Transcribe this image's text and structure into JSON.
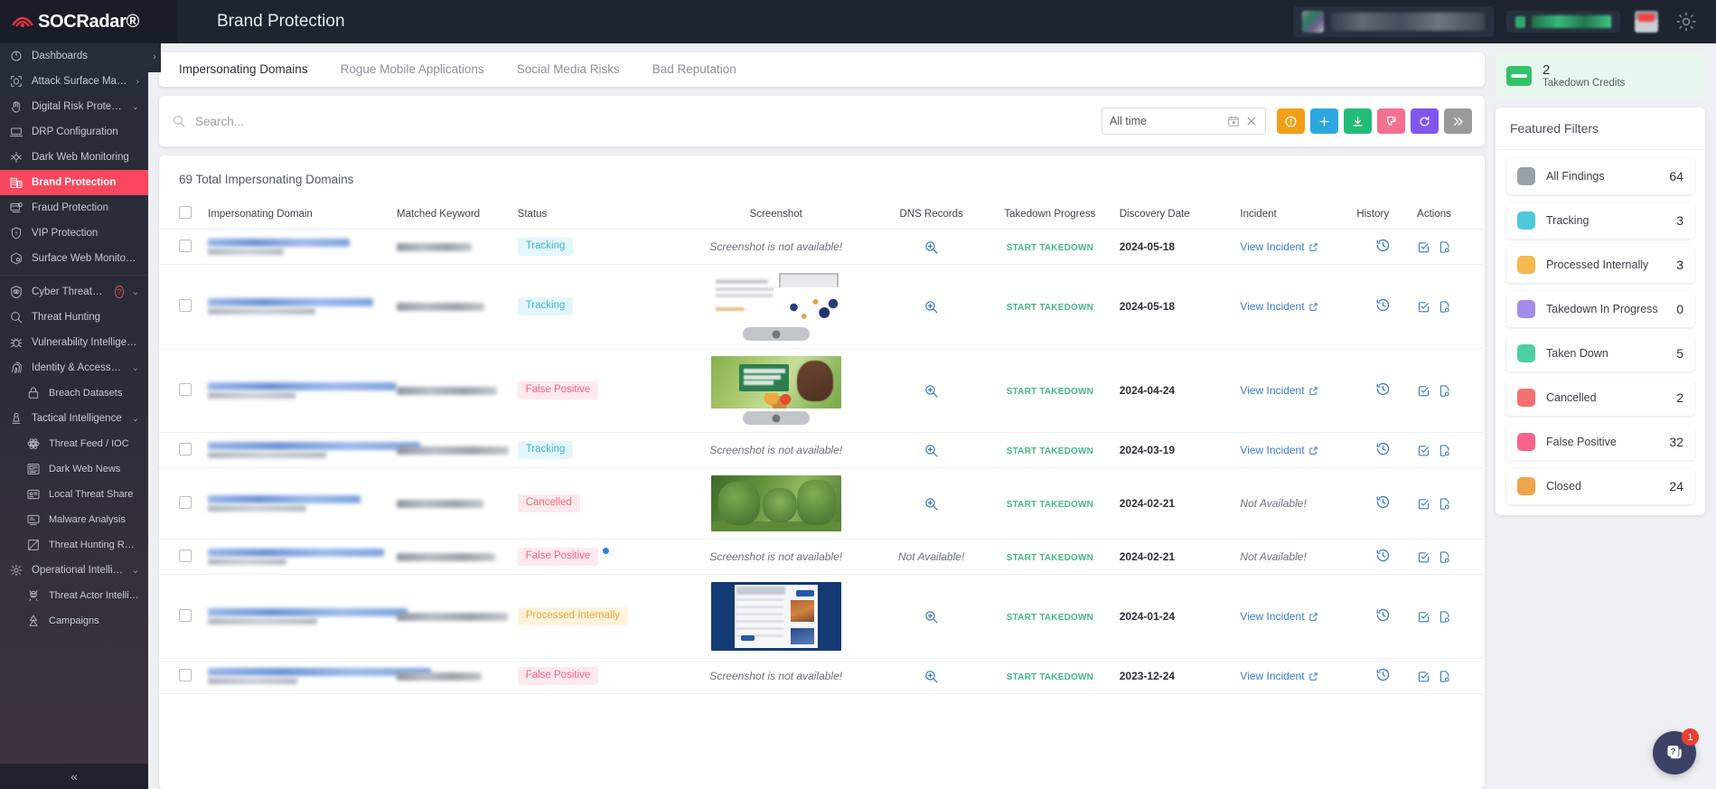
{
  "header": {
    "brand": "SOCRadar",
    "brand_reg": "®",
    "page_title": "Brand Protection",
    "icons": {
      "user_avatar": "avatar",
      "license_status": "license-status",
      "reports": "chart-icon",
      "settings": "gear-icon"
    }
  },
  "sidebar": {
    "collapse_label": "«",
    "items": [
      {
        "label": "Dashboards",
        "icon": "dashboard-icon",
        "type": "item"
      },
      {
        "label": "Attack Surface Management",
        "icon": "attack-surface-icon",
        "type": "item",
        "chevron": "›"
      },
      {
        "label": "Digital Risk Protection",
        "icon": "hand-icon",
        "type": "item",
        "chevron": "⌄",
        "expanded": true
      },
      {
        "label": "DRP Configuration",
        "icon": "laptop-icon",
        "type": "item"
      },
      {
        "label": "Dark Web Monitoring",
        "icon": "spider-icon",
        "type": "item"
      },
      {
        "label": "Brand Protection",
        "icon": "building-icon",
        "type": "item",
        "active": true
      },
      {
        "label": "Fraud Protection",
        "icon": "fraud-icon",
        "type": "item"
      },
      {
        "label": "VIP Protection",
        "icon": "vip-shield-icon",
        "type": "item"
      },
      {
        "label": "Surface Web Monitoring",
        "icon": "web-monitor-icon",
        "type": "item"
      },
      {
        "label": "Cyber Threat Intelligence",
        "icon": "eye-shield-icon",
        "type": "item",
        "chevron": "⌄",
        "badge": "?"
      },
      {
        "label": "Threat Hunting",
        "icon": "search-icon",
        "type": "item"
      },
      {
        "label": "Vulnerability Intelligence",
        "icon": "bug-icon",
        "type": "item"
      },
      {
        "label": "Identity & Access Intelligence",
        "icon": "fingerprint-icon",
        "type": "item",
        "chevron": "⌄"
      },
      {
        "label": "Breach Datasets",
        "icon": "lock-database-icon",
        "type": "sub"
      },
      {
        "label": "Tactical Intelligence",
        "icon": "chess-pawn-icon",
        "type": "item",
        "chevron": "⌄"
      },
      {
        "label": "Threat Feed / IOC",
        "icon": "atom-icon",
        "type": "sub"
      },
      {
        "label": "Dark Web News",
        "icon": "news-icon",
        "type": "sub"
      },
      {
        "label": "Local Threat Share",
        "icon": "share-card-icon",
        "type": "sub"
      },
      {
        "label": "Malware Analysis",
        "icon": "malware-icon",
        "type": "sub"
      },
      {
        "label": "Threat Hunting Rules",
        "icon": "rules-icon",
        "type": "sub"
      },
      {
        "label": "Operational Intelligence",
        "icon": "gear-star-icon",
        "type": "item",
        "chevron": "⌄"
      },
      {
        "label": "Threat Actor Intelligence",
        "icon": "threat-actor-icon",
        "type": "sub"
      },
      {
        "label": "Campaigns",
        "icon": "campaign-icon",
        "type": "sub"
      }
    ]
  },
  "tabs": [
    {
      "label": "Impersonating Domains",
      "active": true
    },
    {
      "label": "Rogue Mobile Applications",
      "active": false
    },
    {
      "label": "Social Media Risks",
      "active": false
    },
    {
      "label": "Bad Reputation",
      "active": false
    }
  ],
  "toolbar": {
    "search_placeholder": "Search...",
    "search_value": "",
    "daterange_value": "All time",
    "buttons": [
      {
        "name": "info-button",
        "icon": "exclamation-circle-icon",
        "color": "#f0a018"
      },
      {
        "name": "add-button",
        "icon": "plus-icon",
        "color": "#2ca8e0"
      },
      {
        "name": "download-button",
        "icon": "download-icon",
        "color": "#23bb78"
      },
      {
        "name": "false-positive-button",
        "icon": "thumbs-down-icon",
        "color": "#f4708f"
      },
      {
        "name": "refresh-button",
        "icon": "refresh-icon",
        "color": "#8156ee"
      },
      {
        "name": "more-button",
        "icon": "double-chevron-right-icon",
        "color": "#9a9a9a"
      }
    ]
  },
  "table": {
    "total_label": "69 Total Impersonating Domains",
    "columns": [
      "Impersonating Domain",
      "Matched Keyword",
      "Status",
      "Screenshot",
      "DNS Records",
      "Takedown Progress",
      "Discovery Date",
      "Incident",
      "History",
      "Actions"
    ],
    "labels": {
      "start_takedown": "START TAKEDOWN",
      "view_incident": "View Incident",
      "screenshot_unavailable": "Screenshot is not available!",
      "not_available": "Not Available!"
    },
    "rows": [
      {
        "status": "Tracking",
        "status_class": "b-tracking",
        "flagged": false,
        "screenshot": "none",
        "dns": "icon",
        "takedown": "START TAKEDOWN",
        "date": "2024-05-18",
        "incident": "View Incident"
      },
      {
        "status": "Tracking",
        "status_class": "b-tracking",
        "flagged": false,
        "screenshot": "art1",
        "dns": "icon",
        "takedown": "START TAKEDOWN",
        "date": "2024-05-18",
        "incident": "View Incident"
      },
      {
        "status": "False Positive",
        "status_class": "b-false",
        "flagged": false,
        "screenshot": "art2",
        "dns": "icon",
        "takedown": "START TAKEDOWN",
        "date": "2024-04-24",
        "incident": "View Incident"
      },
      {
        "status": "Tracking",
        "status_class": "b-tracking",
        "flagged": false,
        "screenshot": "none",
        "dns": "icon",
        "takedown": "START TAKEDOWN",
        "date": "2024-03-19",
        "incident": "View Incident"
      },
      {
        "status": "Cancelled",
        "status_class": "b-cancel",
        "flagged": false,
        "screenshot": "art3",
        "dns": "icon",
        "takedown": "START TAKEDOWN",
        "date": "2024-02-21",
        "incident": "Not Available!"
      },
      {
        "status": "False Positive",
        "status_class": "b-false",
        "flagged": true,
        "screenshot": "none",
        "dns": "na",
        "takedown": "START TAKEDOWN",
        "date": "2024-02-21",
        "incident": "Not Available!"
      },
      {
        "status": "Processed Internally",
        "status_class": "b-proc",
        "flagged": false,
        "screenshot": "art4",
        "dns": "icon",
        "takedown": "START TAKEDOWN",
        "date": "2024-01-24",
        "incident": "View Incident"
      },
      {
        "status": "False Positive",
        "status_class": "b-false",
        "flagged": false,
        "screenshot": "none",
        "dns": "icon",
        "takedown": "START TAKEDOWN",
        "date": "2023-12-24",
        "incident": "View Incident"
      }
    ]
  },
  "credits": {
    "count": "2",
    "label": "Takedown Credits"
  },
  "featured_filters": {
    "title": "Featured Filters",
    "items": [
      {
        "label": "All Findings",
        "count": "64",
        "color": "#9aa0a8"
      },
      {
        "label": "Tracking",
        "count": "3",
        "color": "#4dc8dd"
      },
      {
        "label": "Processed Internally",
        "count": "3",
        "color": "#f5b94f"
      },
      {
        "label": "Takedown In Progress",
        "count": "0",
        "color": "#a48ce8"
      },
      {
        "label": "Taken Down",
        "count": "5",
        "color": "#4ccfa0"
      },
      {
        "label": "Cancelled",
        "count": "2",
        "color": "#f2706f"
      },
      {
        "label": "False Positive",
        "count": "32",
        "color": "#f4648c"
      },
      {
        "label": "Closed",
        "count": "24",
        "color": "#f5a košt"
      }
    ]
  },
  "chat": {
    "badge": "1",
    "icon": "help-chat-icon"
  }
}
